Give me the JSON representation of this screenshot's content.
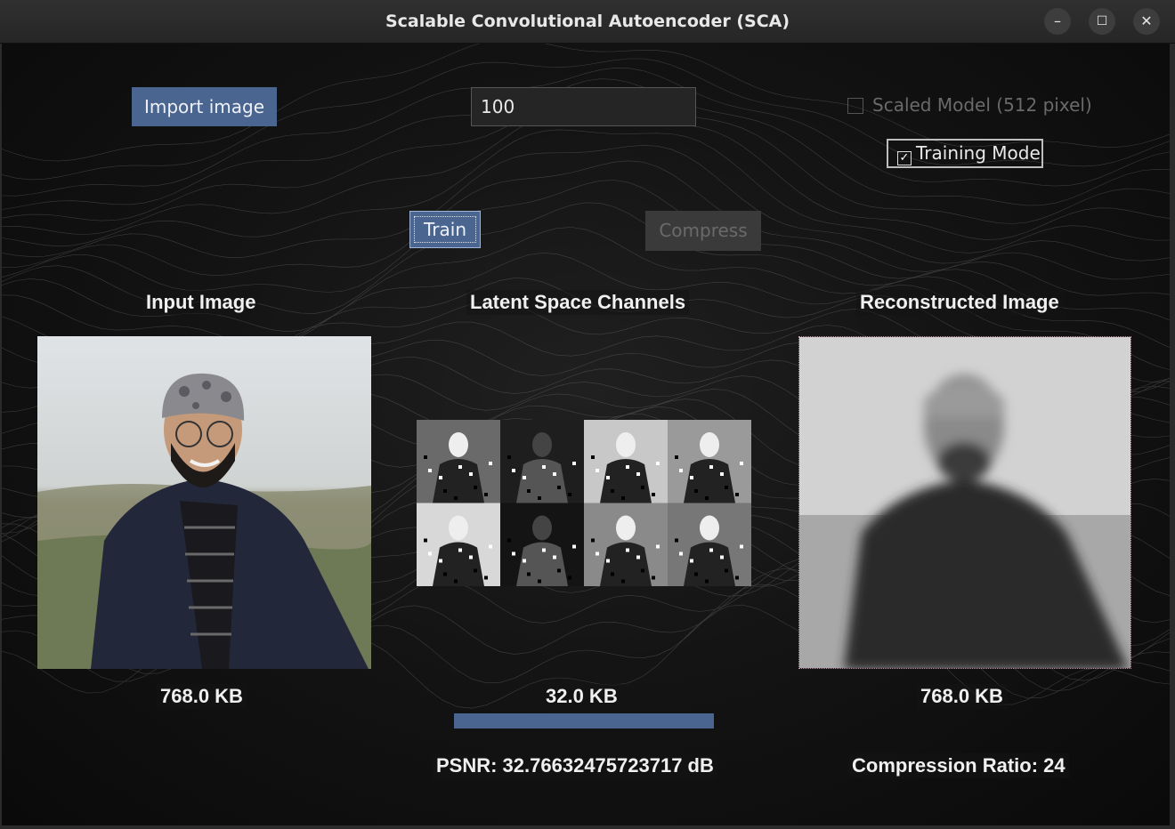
{
  "window": {
    "title": "Scalable Convolutional Autoencoder (SCA)",
    "controls": {
      "minimize": "–",
      "maximize": "☐",
      "close": "✕"
    }
  },
  "toolbar": {
    "import_label": "Import image",
    "epochs_value": "100",
    "scaled_model_label": "Scaled Model (512 pixel)",
    "scaled_model_checked": false,
    "training_mode_label": "Training Mode",
    "training_mode_checked": true,
    "check_mark": "✓",
    "train_label": "Train",
    "compress_label": "Compress"
  },
  "panels": {
    "input": {
      "title": "Input Image",
      "size": "768.0 KB"
    },
    "latent": {
      "title": "Latent Space Channels",
      "size": "32.0 KB"
    },
    "reconstructed": {
      "title": "Reconstructed Image",
      "size": "768.0 KB"
    }
  },
  "progress": {
    "value": 1.0
  },
  "metrics": {
    "psnr": "PSNR: 32.76632475723717 dB",
    "compression_ratio": "Compression Ratio: 24"
  },
  "colors": {
    "accent": "#4a6590",
    "background": "#141414",
    "disabled_text": "#6a6a6a"
  }
}
